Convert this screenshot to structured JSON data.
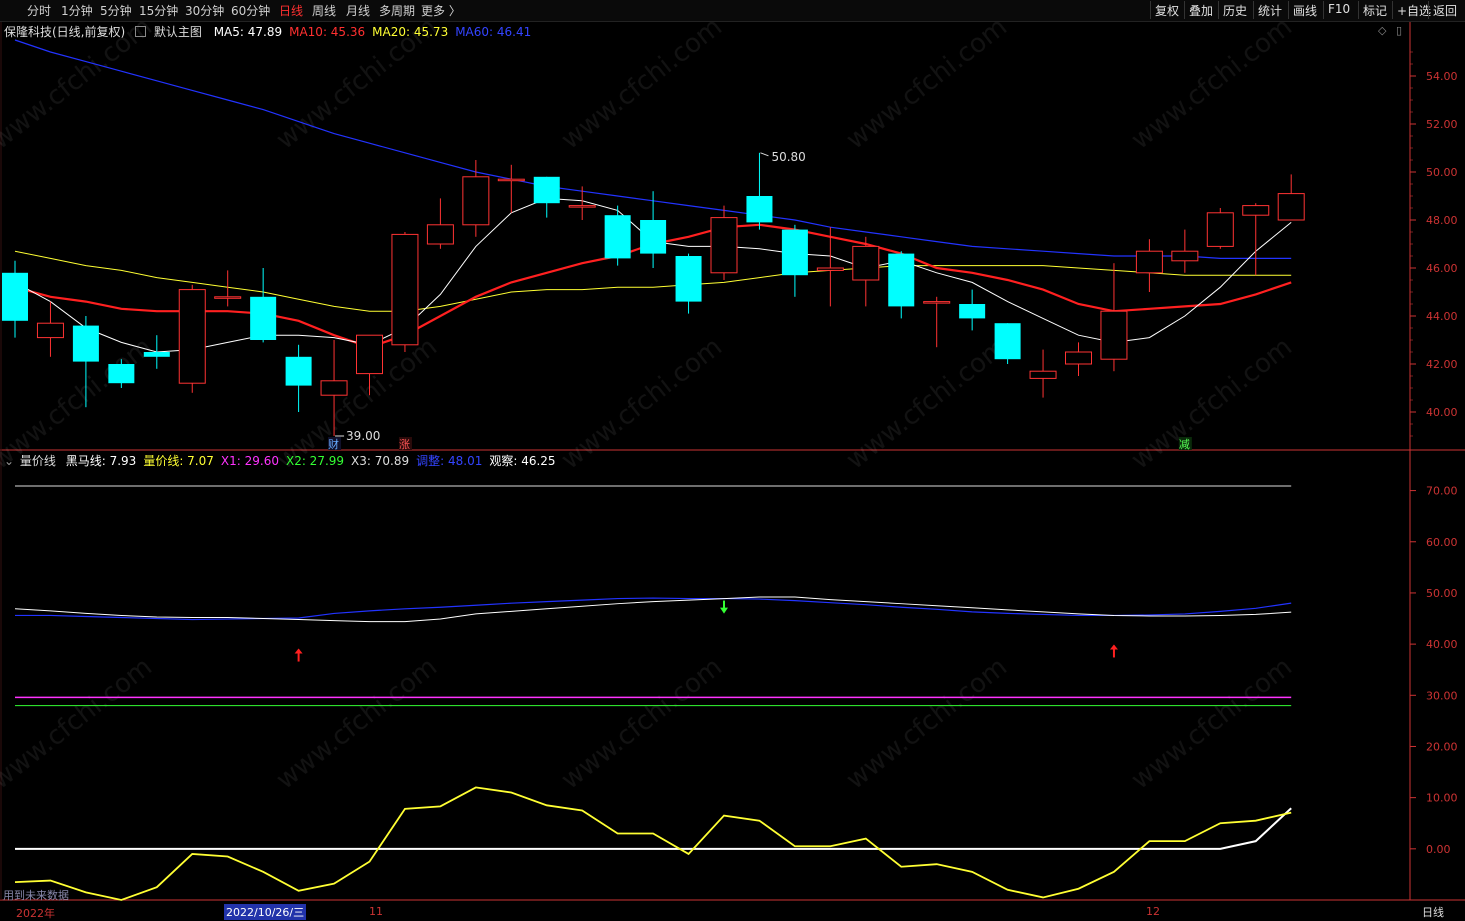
{
  "toolbar": {
    "periods": [
      "分时",
      "1分钟",
      "5分钟",
      "15分钟",
      "30分钟",
      "60分钟",
      "日线",
      "周线",
      "月线",
      "多周期",
      "更多 〉"
    ],
    "active_period": "日线",
    "right_buttons": [
      "复权",
      "叠加",
      "历史",
      "统计",
      "画线",
      "F10",
      "标记",
      "+自选",
      "返回"
    ]
  },
  "main_legend": {
    "stock": "保隆科技(日线,前复权)",
    "template": "默认主图",
    "items": [
      {
        "label": "MA5: 47.89",
        "color": "#ffffff"
      },
      {
        "label": "MA10: 45.36",
        "color": "#ff3030"
      },
      {
        "label": "MA20: 45.73",
        "color": "#ffff33"
      },
      {
        "label": "MA60: 46.41",
        "color": "#3344ff"
      }
    ]
  },
  "sub_legend": {
    "name": "量价线",
    "items": [
      {
        "label": "黑马线: 7.93",
        "color": "#ffffff"
      },
      {
        "label": "量价线: 7.07",
        "color": "#ffff33"
      },
      {
        "label": "X1: 29.60",
        "color": "#ff33ff"
      },
      {
        "label": "X2: 27.99",
        "color": "#33ff33"
      },
      {
        "label": "X3: 70.89",
        "color": "#dddddd"
      },
      {
        "label": "调整: 48.01",
        "color": "#3344ff"
      },
      {
        "label": "观察: 46.25",
        "color": "#ffffff"
      }
    ]
  },
  "price_axis": [
    "54.00",
    "52.00",
    "50.00",
    "48.00",
    "46.00",
    "44.00",
    "42.00",
    "40.00"
  ],
  "sub_axis": [
    "70.00",
    "60.00",
    "50.00",
    "40.00",
    "30.00",
    "20.00",
    "10.00",
    "0.00"
  ],
  "annotations": {
    "high_label": "50.80",
    "low_label": "39.00",
    "marker_cai": "财",
    "marker_zhang": "涨",
    "marker_jian": "减"
  },
  "watermark": "www.cfchi.com",
  "bottom": {
    "warning": "用到未来数据",
    "year": "2022年",
    "cursor_date": "2022/10/26/三",
    "month_11": "11",
    "month_12": "12",
    "period_label": "日线"
  },
  "colors": {
    "up": "#ff3333",
    "down": "#00ffff",
    "axis": "#cc3333",
    "ma5": "#ffffff",
    "ma10": "#ff2020",
    "ma20": "#ffff33",
    "ma60": "#2233ff"
  },
  "chart_data": {
    "type": "candlestick",
    "price_range": [
      38.5,
      55.5
    ],
    "candles": [
      {
        "o": 45.8,
        "c": 43.8,
        "h": 46.3,
        "l": 43.1
      },
      {
        "o": 43.1,
        "c": 43.7,
        "h": 44.6,
        "l": 42.3
      },
      {
        "o": 43.6,
        "c": 42.1,
        "h": 44.0,
        "l": 40.2
      },
      {
        "o": 42.0,
        "c": 41.2,
        "h": 42.2,
        "l": 41.0
      },
      {
        "o": 42.5,
        "c": 42.3,
        "h": 43.2,
        "l": 41.8
      },
      {
        "o": 41.2,
        "c": 45.1,
        "h": 45.3,
        "l": 40.8
      },
      {
        "o": 44.8,
        "c": 44.8,
        "h": 45.9,
        "l": 44.4
      },
      {
        "o": 44.8,
        "c": 43.0,
        "h": 46.0,
        "l": 42.9
      },
      {
        "o": 42.3,
        "c": 41.1,
        "h": 42.8,
        "l": 40.0
      },
      {
        "o": 40.7,
        "c": 41.3,
        "h": 43.0,
        "l": 39.0
      },
      {
        "o": 41.6,
        "c": 43.2,
        "h": 43.2,
        "l": 40.7
      },
      {
        "o": 42.8,
        "c": 47.4,
        "h": 47.5,
        "l": 42.5
      },
      {
        "o": 47.0,
        "c": 47.8,
        "h": 48.9,
        "l": 46.8
      },
      {
        "o": 47.8,
        "c": 49.8,
        "h": 50.5,
        "l": 47.3
      },
      {
        "o": 49.7,
        "c": 49.7,
        "h": 50.3,
        "l": 48.3
      },
      {
        "o": 49.8,
        "c": 48.7,
        "h": 49.8,
        "l": 48.1
      },
      {
        "o": 48.6,
        "c": 48.6,
        "h": 49.4,
        "l": 48.0
      },
      {
        "o": 48.2,
        "c": 46.4,
        "h": 48.6,
        "l": 46.1
      },
      {
        "o": 48.0,
        "c": 46.6,
        "h": 49.2,
        "l": 46.0
      },
      {
        "o": 46.5,
        "c": 44.6,
        "h": 46.6,
        "l": 44.1
      },
      {
        "o": 45.8,
        "c": 48.1,
        "h": 48.6,
        "l": 45.5
      },
      {
        "o": 49.0,
        "c": 47.9,
        "h": 50.8,
        "l": 47.6
      },
      {
        "o": 47.6,
        "c": 45.7,
        "h": 47.8,
        "l": 44.8
      },
      {
        "o": 45.9,
        "c": 46.0,
        "h": 47.7,
        "l": 44.4
      },
      {
        "o": 45.5,
        "c": 46.9,
        "h": 47.3,
        "l": 44.4
      },
      {
        "o": 46.6,
        "c": 44.4,
        "h": 46.7,
        "l": 43.9
      },
      {
        "o": 44.6,
        "c": 44.6,
        "h": 44.8,
        "l": 42.7
      },
      {
        "o": 44.5,
        "c": 43.9,
        "h": 45.1,
        "l": 43.4
      },
      {
        "o": 43.7,
        "c": 42.2,
        "h": 43.7,
        "l": 42.0
      },
      {
        "o": 41.4,
        "c": 41.7,
        "h": 42.6,
        "l": 40.6
      },
      {
        "o": 42.0,
        "c": 42.5,
        "h": 42.9,
        "l": 41.5
      },
      {
        "o": 42.2,
        "c": 44.2,
        "h": 46.2,
        "l": 41.7
      },
      {
        "o": 45.8,
        "c": 46.7,
        "h": 47.2,
        "l": 45.0
      },
      {
        "o": 46.3,
        "c": 46.7,
        "h": 47.6,
        "l": 45.8
      },
      {
        "o": 46.9,
        "c": 48.3,
        "h": 48.5,
        "l": 46.8
      },
      {
        "o": 48.2,
        "c": 48.6,
        "h": 48.7,
        "l": 45.7
      },
      {
        "o": 48.0,
        "c": 49.1,
        "h": 49.9,
        "l": 48.0
      }
    ],
    "ma5": [
      45.4,
      44.6,
      43.5,
      42.9,
      42.5,
      42.6,
      42.9,
      43.2,
      43.2,
      43.1,
      42.8,
      43.5,
      44.9,
      46.9,
      48.3,
      48.9,
      48.8,
      48.4,
      47.1,
      46.9,
      46.9,
      46.8,
      46.6,
      46.5,
      46.0,
      46.3,
      45.8,
      45.4,
      44.6,
      43.9,
      43.2,
      42.9,
      43.1,
      44.0,
      45.2,
      46.7,
      47.9
    ],
    "ma10": [
      45.2,
      44.8,
      44.6,
      44.3,
      44.2,
      44.2,
      44.2,
      44.1,
      43.8,
      43.2,
      42.7,
      43.2,
      44.0,
      44.8,
      45.4,
      45.8,
      46.2,
      46.5,
      47.0,
      47.3,
      47.7,
      47.8,
      47.6,
      47.3,
      47.0,
      46.6,
      46.0,
      45.8,
      45.5,
      45.1,
      44.5,
      44.2,
      44.3,
      44.4,
      44.5,
      44.9,
      45.4
    ],
    "ma20": [
      46.7,
      46.4,
      46.1,
      45.9,
      45.6,
      45.4,
      45.2,
      45.0,
      44.7,
      44.4,
      44.2,
      44.2,
      44.4,
      44.7,
      45.0,
      45.1,
      45.1,
      45.2,
      45.2,
      45.3,
      45.4,
      45.6,
      45.8,
      45.9,
      46.0,
      46.1,
      46.1,
      46.1,
      46.1,
      46.1,
      46.0,
      45.9,
      45.8,
      45.7,
      45.7,
      45.7,
      45.7
    ],
    "ma60": [
      55.5,
      55.0,
      54.6,
      54.2,
      53.8,
      53.4,
      53.0,
      52.6,
      52.1,
      51.6,
      51.2,
      50.8,
      50.4,
      50.0,
      49.7,
      49.4,
      49.2,
      49.0,
      48.8,
      48.6,
      48.4,
      48.2,
      48.0,
      47.7,
      47.5,
      47.3,
      47.1,
      46.9,
      46.8,
      46.7,
      46.6,
      46.5,
      46.5,
      46.5,
      46.4,
      46.4,
      46.4
    ],
    "sub_range": [
      -10,
      75
    ],
    "x3": 70.89,
    "x1": 29.6,
    "x2": 27.99,
    "tiaozheng": [
      45.6,
      45.6,
      45.4,
      45.2,
      45.0,
      44.8,
      44.9,
      45.0,
      45.1,
      46.0,
      46.5,
      46.9,
      47.2,
      47.6,
      48.0,
      48.3,
      48.6,
      48.9,
      49.0,
      48.9,
      48.9,
      48.8,
      48.5,
      48.1,
      47.7,
      47.2,
      46.8,
      46.3,
      46.0,
      45.8,
      45.6,
      45.6,
      45.7,
      45.9,
      46.4,
      47.0,
      48.01
    ],
    "guancha": [
      46.9,
      46.5,
      46.0,
      45.6,
      45.3,
      45.2,
      45.2,
      45.0,
      44.8,
      44.6,
      44.4,
      44.4,
      44.9,
      45.9,
      46.4,
      46.9,
      47.4,
      47.9,
      48.3,
      48.6,
      48.9,
      49.2,
      49.2,
      48.7,
      48.3,
      47.9,
      47.5,
      47.1,
      46.7,
      46.3,
      45.9,
      45.6,
      45.5,
      45.5,
      45.6,
      45.8,
      46.25
    ],
    "liangjia": [
      -6.5,
      -6.2,
      -8.5,
      -10.0,
      -7.5,
      -1.0,
      -1.5,
      -4.5,
      -8.2,
      -6.8,
      -2.5,
      7.8,
      8.3,
      12.0,
      11.0,
      8.5,
      7.5,
      3.0,
      3.0,
      -1.0,
      6.5,
      5.5,
      0.5,
      0.5,
      2.0,
      -3.5,
      -3.0,
      -4.5,
      -8.0,
      -9.5,
      -7.8,
      -4.5,
      1.5,
      1.5,
      5.0,
      5.5,
      7.07
    ],
    "heima": [
      0,
      0,
      0,
      0,
      0,
      0,
      0,
      0,
      0,
      0,
      0,
      0,
      0,
      0,
      0,
      0,
      0,
      0,
      0,
      0,
      0,
      0,
      0,
      0,
      0,
      0,
      0,
      0,
      0,
      0,
      0,
      0,
      0,
      0,
      0,
      1.5,
      7.93
    ],
    "up_arrows": [
      8,
      31
    ],
    "down_arrows": [
      20
    ]
  }
}
